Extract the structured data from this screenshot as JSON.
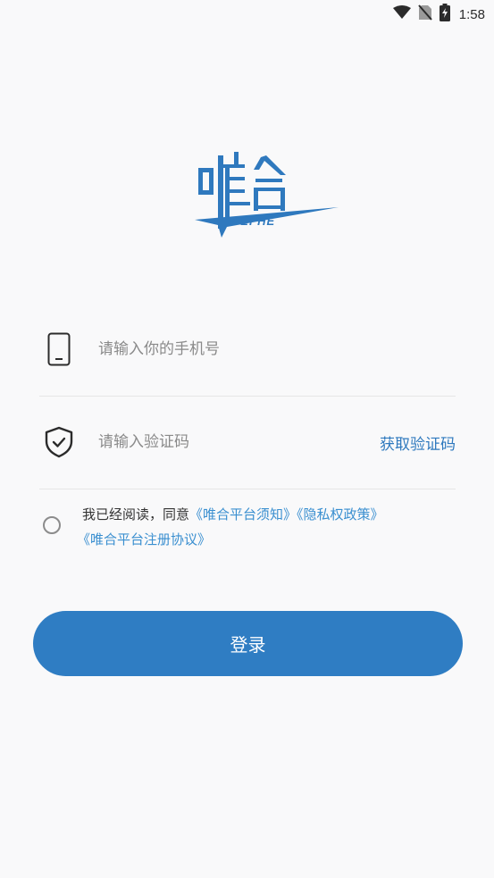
{
  "status_bar": {
    "time": "1:58",
    "icons": [
      "wifi-icon",
      "no-sim-icon",
      "battery-charging-icon"
    ]
  },
  "logo": {
    "wordmark": "WEI HE",
    "color": "#2f79be"
  },
  "form": {
    "phone": {
      "placeholder": "请输入你的手机号",
      "icon": "phone-icon"
    },
    "code": {
      "placeholder": "请输入验证码",
      "icon": "shield-check-icon",
      "get_code_label": "获取验证码"
    }
  },
  "agreement": {
    "prefix": "我已经阅读，同意",
    "link1": "《唯合平台须知》",
    "link2": "《隐私权政策》",
    "link3": "《唯合平台注册协议》"
  },
  "login": {
    "label": "登录"
  },
  "colors": {
    "primary": "#2f7dc3",
    "link": "#3a8fd0",
    "background": "#f9f9fa"
  }
}
